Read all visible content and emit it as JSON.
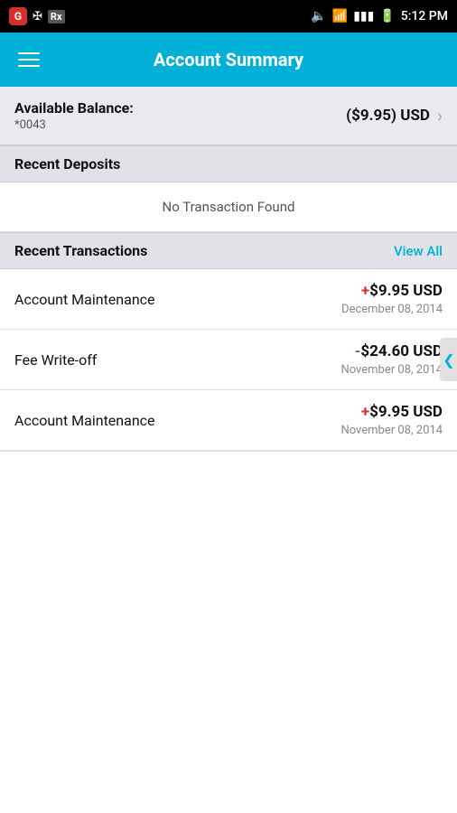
{
  "statusBar": {
    "time": "5:12 PM",
    "icons": {
      "g": "G",
      "usb": "⑂",
      "rx": "Rx"
    }
  },
  "header": {
    "title": "Account Summary",
    "menuLabel": "Menu"
  },
  "balance": {
    "label": "Available Balance:",
    "accountNumber": "*0043",
    "amount": "($9.95) USD"
  },
  "recentDeposits": {
    "sectionTitle": "Recent Deposits",
    "emptyMessage": "No Transaction Found"
  },
  "recentTransactions": {
    "sectionTitle": "Recent Transactions",
    "viewAllLabel": "View All",
    "items": [
      {
        "name": "Account Maintenance",
        "sign": "+",
        "amount": "$9.95 USD",
        "date": "December 08, 2014",
        "type": "positive"
      },
      {
        "name": "Fee Write-off",
        "sign": "-",
        "amount": "$24.60 USD",
        "date": "November 08, 2014",
        "type": "negative"
      },
      {
        "name": "Account Maintenance",
        "sign": "+",
        "amount": "$9.95 USD",
        "date": "November 08, 2014",
        "type": "positive"
      }
    ]
  }
}
